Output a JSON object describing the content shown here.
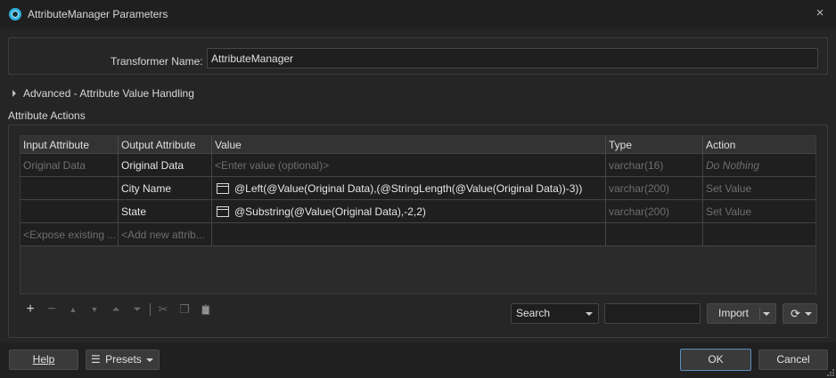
{
  "window": {
    "title": "AttributeManager Parameters",
    "close_icon": "×"
  },
  "transformer": {
    "label": "Transformer Name:",
    "value": "AttributeManager"
  },
  "advanced": {
    "label": "Advanced - Attribute Value Handling"
  },
  "attribute_actions": {
    "label": "Attribute Actions",
    "columns": [
      "Input Attribute",
      "Output Attribute",
      "Value",
      "Type",
      "Action"
    ],
    "rows": [
      {
        "input": "Original Data",
        "output": "Original Data",
        "value": "<Enter value (optional)>",
        "type": "varchar(16)",
        "action": "Do Nothing"
      },
      {
        "input": "",
        "output": "City Name",
        "value": "@Left(@Value(Original Data),(@StringLength(@Value(Original Data))-3))",
        "type": "varchar(200)",
        "action": "Set Value"
      },
      {
        "input": "",
        "output": "State",
        "value": "@Substring(@Value(Original Data),-2,2)",
        "type": "varchar(200)",
        "action": "Set Value"
      },
      {
        "input": "<Expose existing ...",
        "output": "<Add new attrib...",
        "value": "",
        "type": "",
        "action": ""
      }
    ]
  },
  "toolbar": {
    "add_icon": "+",
    "remove_icon": "−",
    "move_up_icon": "▲",
    "move_down_icon": "▼",
    "move_top_icon": "⏶",
    "move_bottom_icon": "⏷",
    "cut_icon": "✂",
    "copy_icon": "❐",
    "paste_icon": "📋"
  },
  "search": {
    "select_value": "Search",
    "input_value": ""
  },
  "import": {
    "label": "Import"
  },
  "sync": {
    "icon": "⟳"
  },
  "footer": {
    "help_label": "Help",
    "presets_label": "Presets",
    "presets_icon": "☰",
    "ok_label": "OK",
    "cancel_label": "Cancel"
  }
}
